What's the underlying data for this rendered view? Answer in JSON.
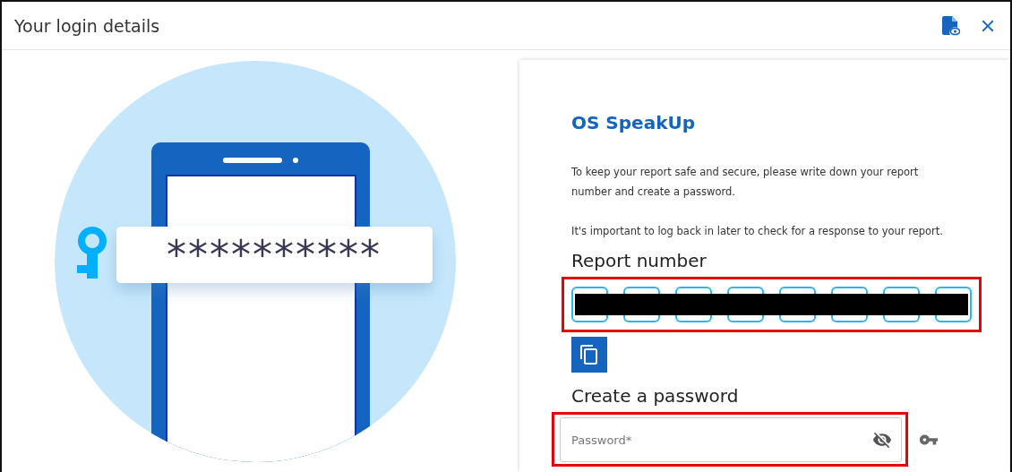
{
  "window": {
    "title": "Your login details"
  },
  "illustration": {
    "password_mask": "**********"
  },
  "card": {
    "brand": "OS SpeakUp",
    "paragraphs": [
      "To keep your report safe and secure, please write down your report number and create a password.",
      "It's important to log back in later to check for a response to your report."
    ],
    "report_number": {
      "heading": "Report number",
      "highlighted": true,
      "redacted": true,
      "cells": [
        {
          "kind": "digit"
        },
        {
          "kind": "digit"
        },
        {
          "kind": "digit"
        },
        {
          "kind": "digit"
        },
        {
          "kind": "digit"
        },
        {
          "kind": "digit"
        },
        {
          "kind": "digit"
        },
        {
          "kind": "digit"
        }
      ]
    },
    "password": {
      "heading": "Create a password",
      "placeholder": "Password*",
      "highlighted": true,
      "visible": false
    }
  }
}
